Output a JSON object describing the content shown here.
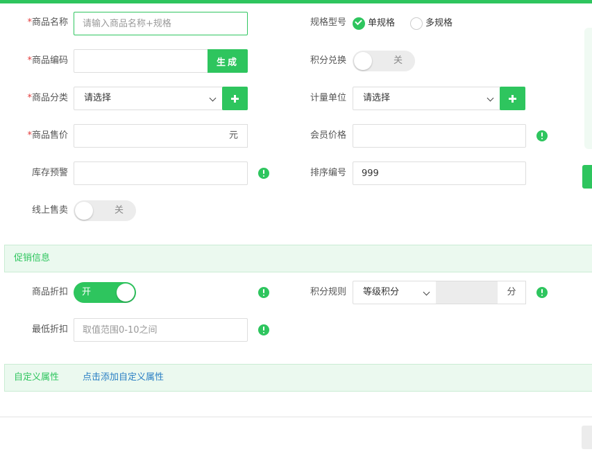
{
  "colors": {
    "accent": "#2ec55e",
    "required": "#e23b3b",
    "link": "#2a7fc4"
  },
  "required_mark": "*",
  "form": {
    "name": {
      "label": "商品名称",
      "required": true,
      "placeholder": "请输入商品名称+规格"
    },
    "code": {
      "label": "商品编码",
      "required": true,
      "value": "",
      "generate_label": "生成"
    },
    "category": {
      "label": "商品分类",
      "required": true,
      "selected": "请选择"
    },
    "price": {
      "label": "商品售价",
      "required": true,
      "value": "",
      "unit": "元"
    },
    "stock_alert": {
      "label": "库存预警",
      "value": ""
    },
    "online": {
      "label": "线上售卖",
      "state": "关"
    },
    "spec": {
      "label": "规格型号",
      "options": [
        "单规格",
        "多规格"
      ],
      "selected": "单规格"
    },
    "points_exchange": {
      "label": "积分兑换",
      "state": "关"
    },
    "measure_unit": {
      "label": "计量单位",
      "selected": "请选择"
    },
    "member_price": {
      "label": "会员价格",
      "value": ""
    },
    "sort_no": {
      "label": "排序编号",
      "value": "999"
    }
  },
  "promo": {
    "title": "促销信息",
    "discount": {
      "label": "商品折扣",
      "state": "开"
    },
    "min_discount": {
      "label": "最低折扣",
      "placeholder": "取值范围0-10之间"
    },
    "points_rule": {
      "label": "积分规则",
      "selected": "等级积分",
      "value": "",
      "unit": "分"
    }
  },
  "custom": {
    "title": "自定义属性",
    "link": "点击添加自定义属性"
  }
}
